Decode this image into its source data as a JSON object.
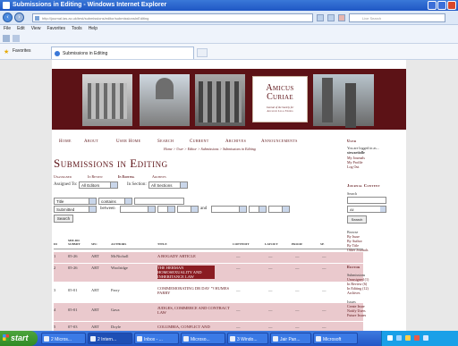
{
  "window": {
    "title": "Submissions in Editing - Windows Internet Explorer"
  },
  "browser": {
    "url": "http://journal.ias.ac.uk/test/submissions/editor/submissionsInEditing",
    "live_search_placeholder": "Live Search",
    "menu": [
      "File",
      "Edit",
      "View",
      "Favorites",
      "Tools",
      "Help"
    ],
    "favorites_label": "Favorites",
    "tab_title": "Submissions in Editing"
  },
  "site": {
    "logo_title": "Amicus Curiae",
    "logo_sub": "Journal of the Society for",
    "logo_sub2": "Advanced Legal Studies"
  },
  "nav": [
    "Home",
    "About",
    "User Home",
    "Search",
    "Current",
    "Archives",
    "Announcements"
  ],
  "breadcrumb": "Home > User > Editor > Submissions > Submissions in Editing",
  "page_title": "Submissions in Editing",
  "tabs": [
    "Unassigned",
    "In Review",
    "In Editing",
    "Archives"
  ],
  "filters": {
    "assigned_label": "Assigned To:",
    "assigned_value": "All Editors",
    "section_label": "In Section:",
    "section_value": "All Sections",
    "field_value": "Title",
    "match_value": "contains",
    "date_field_value": "Submitted",
    "between_label": "between",
    "and_label": "and",
    "search_button": "Search"
  },
  "table": {
    "headers": [
      "ID",
      "MM-DD SUBMIT",
      "SEC",
      "AUTHORS",
      "TITLE",
      "COPYEDIT",
      "LAYOUT",
      "PROOF",
      "SE"
    ],
    "rows": [
      {
        "id": "1",
        "date": "05-26",
        "sec": "ART",
        "author": "McNicholl",
        "title": "A BOGADY ARTICLE",
        "copy": "—",
        "layout": "—",
        "proof": "—",
        "se": "—"
      },
      {
        "id": "2",
        "date": "05-26",
        "sec": "ART",
        "author": "Woolridge",
        "title": "THE HERMAN HOMOSEXUALITY AND INHERITANCE LAW",
        "copy": "—",
        "layout": "—",
        "proof": "—",
        "se": "—"
      },
      {
        "id": "3",
        "date": "05-01",
        "sec": "ART",
        "author": "Parry",
        "title": "COMMEMORATING DR DAVID HUMES PARRY",
        "copy": "—",
        "layout": "—",
        "proof": "—",
        "se": "—"
      },
      {
        "id": "4",
        "date": "05-01",
        "sec": "ART",
        "author": "Gava",
        "title": "JUDGES, COMMERCE AND CONTRACT LAW",
        "copy": "—",
        "layout": "—",
        "proof": "—",
        "se": "—"
      },
      {
        "id": "5",
        "date": "07-03",
        "sec": "ART",
        "author": "Doyle",
        "title": "COLUMBIA, CONFLICT AND",
        "copy": "—",
        "layout": "—",
        "proof": "—",
        "se": "—"
      }
    ]
  },
  "sidebar": {
    "user_heading": "User",
    "logged_in": "You are logged in as...",
    "username": "stewartiolle",
    "links": [
      "My Journals",
      "My Profile",
      "Log Out"
    ],
    "journal_content_heading": "Journal Content",
    "search_label": "Search",
    "search_scope": "All",
    "search_button": "Search",
    "browse_label": "Browse",
    "browse_links": [
      "By Issue",
      "By Author",
      "By Title",
      "Other Journals"
    ],
    "editor_heading": "Editor",
    "submissions_label": "Submissions",
    "submission_links": [
      "Unassigned (1)",
      "In Review (6)",
      "In Editing (12)",
      "Archives"
    ],
    "issues_label": "Issues",
    "issue_links": [
      "Create Issue",
      "Notify Users",
      "Future Issues"
    ]
  },
  "taskbar": {
    "start": "start",
    "tasks": [
      "2 Micros...",
      "2 Intern...",
      "Inbox - ...",
      "Microso...",
      "3 Windo...",
      "Jair Pan...",
      "Microsoft"
    ]
  }
}
